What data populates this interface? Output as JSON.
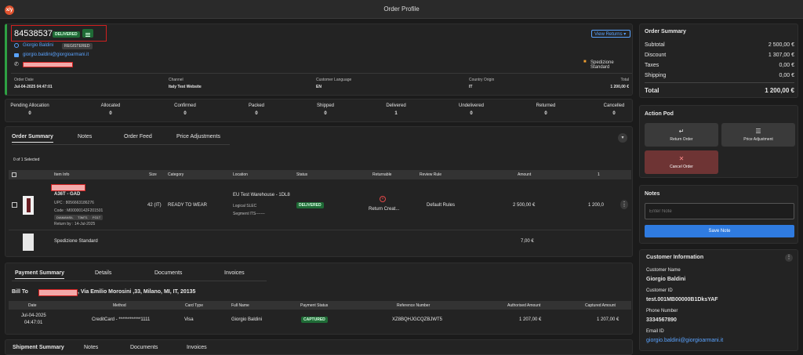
{
  "app": {
    "title": "Order Profile",
    "logo": "x/y"
  },
  "order": {
    "number": "84538537",
    "status": "DELIVERED",
    "customer_name": "Giorgio Baldini",
    "customer_tag": "REGISTERED",
    "email": "giorgio.baldini@giorgioarmani.it",
    "view_returns": "View Returns",
    "shipping_method": "Spedizione Standard",
    "fields": [
      {
        "label": "Order Date",
        "value": "Jul-04-2025 04:47:01"
      },
      {
        "label": "Channel",
        "value": "Italy Test Website"
      },
      {
        "label": "Customer Language",
        "value": "EN"
      },
      {
        "label": "Country Origin",
        "value": "IT"
      },
      {
        "label": "Total",
        "value": "1 200,00 €"
      }
    ]
  },
  "counters": [
    {
      "label": "Pending Allocation",
      "value": "0"
    },
    {
      "label": "Allocated",
      "value": "0"
    },
    {
      "label": "Confirmed",
      "value": "0"
    },
    {
      "label": "Packed",
      "value": "0"
    },
    {
      "label": "Shipped",
      "value": "0"
    },
    {
      "label": "Delivered",
      "value": "1"
    },
    {
      "label": "Undelivered",
      "value": "0"
    },
    {
      "label": "Returned",
      "value": "0"
    },
    {
      "label": "Cancelled",
      "value": "0"
    }
  ],
  "order_tabs": [
    "Order Summary",
    "Notes",
    "Order Feed",
    "Price Adjustments"
  ],
  "selected_text": "0 of 1 Selected",
  "items_headers": [
    "Item Info",
    "Size",
    "Category",
    "Location",
    "Status",
    "Returnable",
    "Review Rule",
    "Amount",
    "1"
  ],
  "item": {
    "name": "A36T - GAD",
    "upc": "UPC : 8056663186276",
    "code": "Code : M00000142F201501",
    "tags": [
      "DIAMANSIL",
      "T3MT1",
      "FG1T"
    ],
    "return_by": "Return by : 14-Jul-2025",
    "size": "42 (IT)",
    "category": "READY TO WEAR",
    "location": "EU Test Warehouse - 1DL8",
    "location_sub1": "Logical SLEC",
    "location_sub2": "Segment ITS-------",
    "status": "DELIVERED",
    "returnable": "Return Creat...",
    "review_rule": "Default Rules",
    "amount": "2 500,00 €",
    "qty": "1 200,0"
  },
  "shipping_row": {
    "name": "Spedizione Standard",
    "amount": "7,00 €"
  },
  "payment_tabs": [
    "Payment Summary",
    "Details",
    "Documents",
    "Invoices"
  ],
  "bill_to": {
    "label": "Bill To",
    "address": ", Via Emilio Morosini ,33, Milano, MI, IT, 20135"
  },
  "payment_headers": [
    "Date",
    "Method",
    "Card Type",
    "Full Name",
    "Payment Status",
    "Reference Number",
    "Authorised Amount",
    "Captured Amount"
  ],
  "payment_row": {
    "date": "Jul-04-2025",
    "time": "04:47:01",
    "method": "CreditCard - ************1111",
    "card": "Visa",
    "name": "Giorgio Baldini",
    "status": "CAPTURED",
    "ref": "XZ8BQHJGCQZBJWT5",
    "auth": "1 207,00 €",
    "captured": "1 207,00 €"
  },
  "shipment_tabs": [
    "Shipment Summary",
    "Notes",
    "Documents",
    "Invoices"
  ],
  "summary": {
    "title": "Order Summary",
    "rows": [
      {
        "label": "Subtotal",
        "value": "2 500,00 €"
      },
      {
        "label": "Discount",
        "value": "1 307,00 €"
      },
      {
        "label": "Taxes",
        "value": "0,00 €"
      },
      {
        "label": "Shipping",
        "value": "0,00 €"
      }
    ],
    "total_label": "Total",
    "total_value": "1 200,00 €"
  },
  "action_pod": {
    "title": "Action Pod",
    "return": "Return Order",
    "price": "Price Adjustment",
    "cancel": "Cancel Order"
  },
  "notes": {
    "title": "Notes",
    "placeholder": "Enter Note",
    "save": "Save Note"
  },
  "customer_info": {
    "title": "Customer Information",
    "fields": [
      {
        "label": "Customer Name",
        "value": "Giorgio Baldini"
      },
      {
        "label": "Customer ID",
        "value": "test.001MB00000B1DksYAF"
      },
      {
        "label": "Phone Number",
        "value": "3334567890"
      },
      {
        "label": "Email ID",
        "value": "giorgio.baldini@giorgioarmani.it"
      }
    ]
  }
}
